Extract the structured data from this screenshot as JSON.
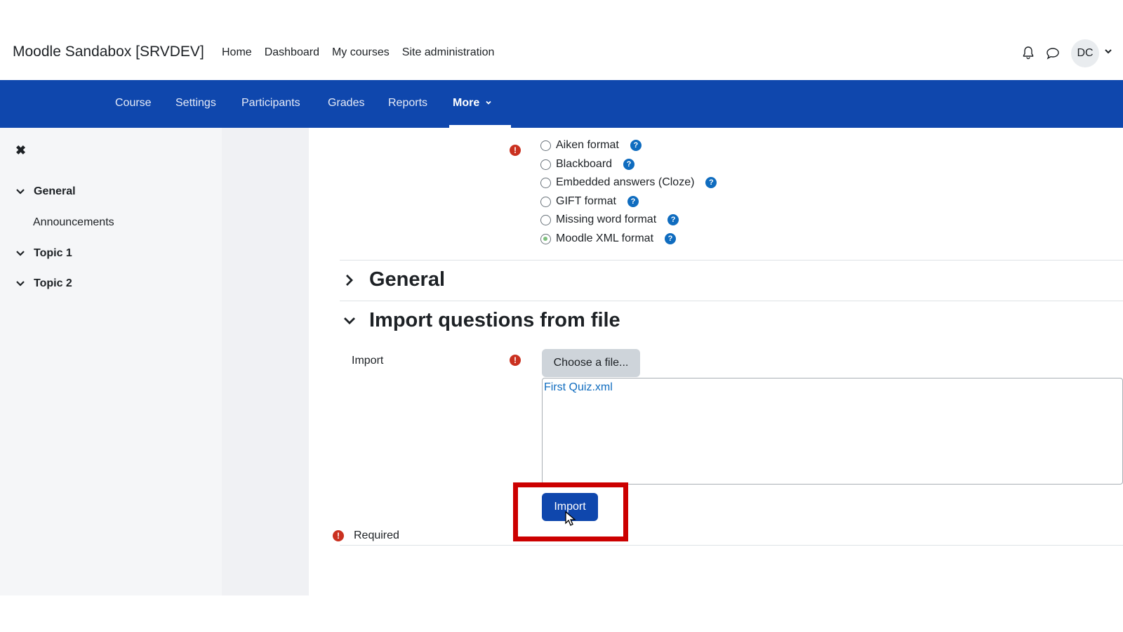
{
  "header": {
    "site_name": "Moodle Sandabox [SRVDEV]",
    "nav": [
      "Home",
      "Dashboard",
      "My courses",
      "Site administration"
    ],
    "avatar_initials": "DC"
  },
  "secondary_nav": {
    "items": [
      "Course",
      "Settings",
      "Participants",
      "Grades",
      "Reports"
    ],
    "more_label": "More"
  },
  "drawer": {
    "close_glyph": "✖",
    "sections": [
      {
        "label": "General",
        "children": [
          "Announcements"
        ]
      },
      {
        "label": "Topic 1",
        "children": []
      },
      {
        "label": "Topic 2",
        "children": []
      }
    ]
  },
  "form": {
    "formats": [
      {
        "label": "Aiken format",
        "checked": false
      },
      {
        "label": "Blackboard",
        "checked": false
      },
      {
        "label": "Embedded answers (Cloze)",
        "checked": false
      },
      {
        "label": "GIFT format",
        "checked": false
      },
      {
        "label": "Missing word format",
        "checked": false
      },
      {
        "label": "Moodle XML format",
        "checked": true
      }
    ],
    "general_heading": "General",
    "import_heading": "Import questions from file",
    "import_label": "Import",
    "choose_file_label": "Choose a file...",
    "file_name": "First Quiz.xml",
    "import_button": "Import",
    "required_text": "Required",
    "help_glyph": "?",
    "required_glyph": "!"
  },
  "colors": {
    "secondary_nav_bg": "#0f47ad",
    "primary_button": "#0f47ad",
    "required_red": "#ca3120",
    "highlight_box": "#cc0000"
  }
}
